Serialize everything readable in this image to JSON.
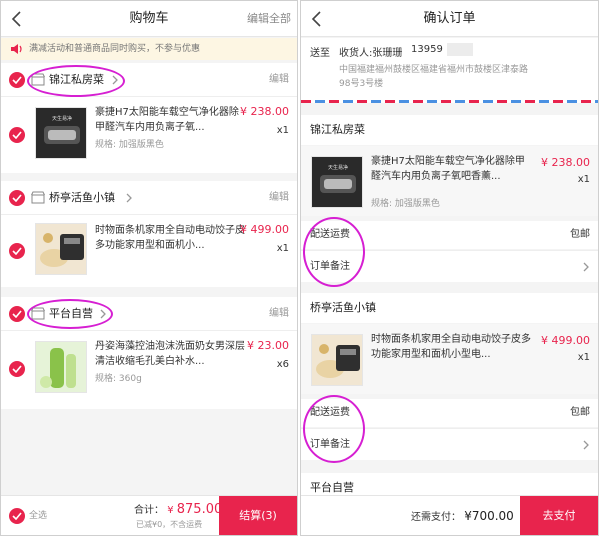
{
  "cart": {
    "title": "购物车",
    "edit_all": "编辑全部",
    "notice": "满减活动和普通商品同时购买，不参与优惠",
    "edit_label": "编辑",
    "shops": [
      {
        "name": "锦江私房菜",
        "item": {
          "title": "豪捷H7太阳能车载空气净化器除甲醛汽车内用负离子氧...",
          "spec": "规格: 加强版黑色",
          "price": "¥ 238.00",
          "qty": "x1"
        }
      },
      {
        "name": "桥亭活鱼小镇",
        "item": {
          "title": "时物面条机家用全自动电动饺子皮多功能家用型和面机小...",
          "spec": "",
          "price": "¥ 499.00",
          "qty": "x1"
        }
      },
      {
        "name": "平台自营",
        "item": {
          "title": "丹姿海藻控油泡沫洗面奶女男深层清洁收缩毛孔美白补水...",
          "spec": "规格: 360g",
          "price": "¥ 23.00",
          "qty": "x6"
        }
      }
    ],
    "footer": {
      "select_all": "全选",
      "total_label": "合计：",
      "currency": "¥",
      "total_value": "875.00",
      "discount_note": "已减¥0，不含运费",
      "checkout": "结算(3)"
    }
  },
  "confirm": {
    "title": "确认订单",
    "address": {
      "ship_to": "送至",
      "receiver": "收货人:张珊珊",
      "phone": "13959",
      "line1": "中国福建福州鼓楼区福建省福州市鼓楼区津泰路",
      "line2": "98号3号楼"
    },
    "shops": [
      {
        "name": "锦江私房菜",
        "item": {
          "title": "豪捷H7太阳能车载空气净化器除甲醛汽车内用负离子氧吧香薰...",
          "spec": "规格: 加强版黑色",
          "price": "¥ 238.00",
          "qty": "x1"
        },
        "shipping_label": "配送运费",
        "shipping_value": "包邮",
        "remark_label": "订单备注"
      },
      {
        "name": "桥亭活鱼小镇",
        "item": {
          "title": "时物面条机家用全自动电动饺子皮多功能家用型和面机小型电...",
          "spec": "",
          "price": "¥ 499.00",
          "qty": "x1"
        },
        "shipping_label": "配送运费",
        "shipping_value": "包邮",
        "remark_label": "订单备注"
      },
      {
        "name": "平台自营"
      }
    ],
    "footer": {
      "pay_label": "还需支付：",
      "pay_value": "¥700.00",
      "pay_button": "去支付"
    }
  },
  "colors": {
    "accent": "#e8244d",
    "annotation": "#d61fd2",
    "notice_bg": "#fdf6e3"
  }
}
